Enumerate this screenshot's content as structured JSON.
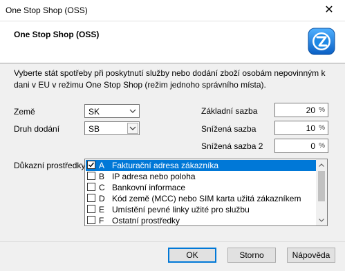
{
  "window": {
    "title": "One Stop Shop (OSS)",
    "close_glyph": "✕"
  },
  "header": {
    "title": "One Stop Shop (OSS)",
    "logo_icon": "app-logo-icon",
    "logo_color": "#1e88e5"
  },
  "description": "Vyberte stát spotřeby při poskytnutí služby nebo dodání zboží osobám nepovinným k dani v EU v režimu One Stop Shop (režim jednoho správního místa).",
  "form": {
    "country": {
      "label": "Země",
      "value": "SK"
    },
    "delivery": {
      "label": "Druh dodání",
      "value": "SB"
    },
    "base_rate": {
      "label": "Základní sazba",
      "value": "20",
      "unit": "%"
    },
    "reduced_rate": {
      "label": "Snížená sazba",
      "value": "10",
      "unit": "%"
    },
    "reduced_rate2": {
      "label": "Snížená sazba 2",
      "value": "0",
      "unit": "%"
    }
  },
  "evidence": {
    "label": "Důkazní prostředky",
    "items": [
      {
        "letter": "A",
        "text": "Fakturační adresa zákazníka",
        "checked": true,
        "selected": true
      },
      {
        "letter": "B",
        "text": "IP adresa nebo poloha",
        "checked": false,
        "selected": false
      },
      {
        "letter": "C",
        "text": "Bankovní informace",
        "checked": false,
        "selected": false
      },
      {
        "letter": "D",
        "text": "Kód země (MCC) nebo SIM karta užitá zákazníkem",
        "checked": false,
        "selected": false
      },
      {
        "letter": "E",
        "text": "Umístění pevné linky užité pro službu",
        "checked": false,
        "selected": false
      },
      {
        "letter": "F",
        "text": "Ostatní prostředky",
        "checked": false,
        "selected": false
      }
    ]
  },
  "buttons": {
    "ok": "OK",
    "cancel": "Storno",
    "help": "Nápověda"
  },
  "colors": {
    "selection": "#0078d7",
    "dialog_bg": "#f0f0f0"
  }
}
